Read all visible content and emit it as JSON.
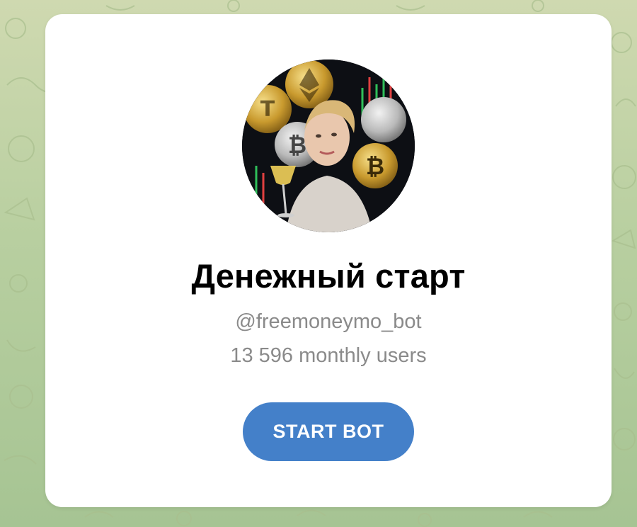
{
  "bot": {
    "name": "Денежный старт",
    "username": "@freemoneymo_bot",
    "monthly_users": "13 596 monthly users",
    "start_button_label": "START BOT"
  },
  "colors": {
    "background_top": "#cfd9b0",
    "background_bottom": "#a6c493",
    "card": "#ffffff",
    "button": "#4480c9",
    "secondary_text": "#8a8a8a"
  },
  "avatar": {
    "description_icon": "profile-photo-icon"
  }
}
